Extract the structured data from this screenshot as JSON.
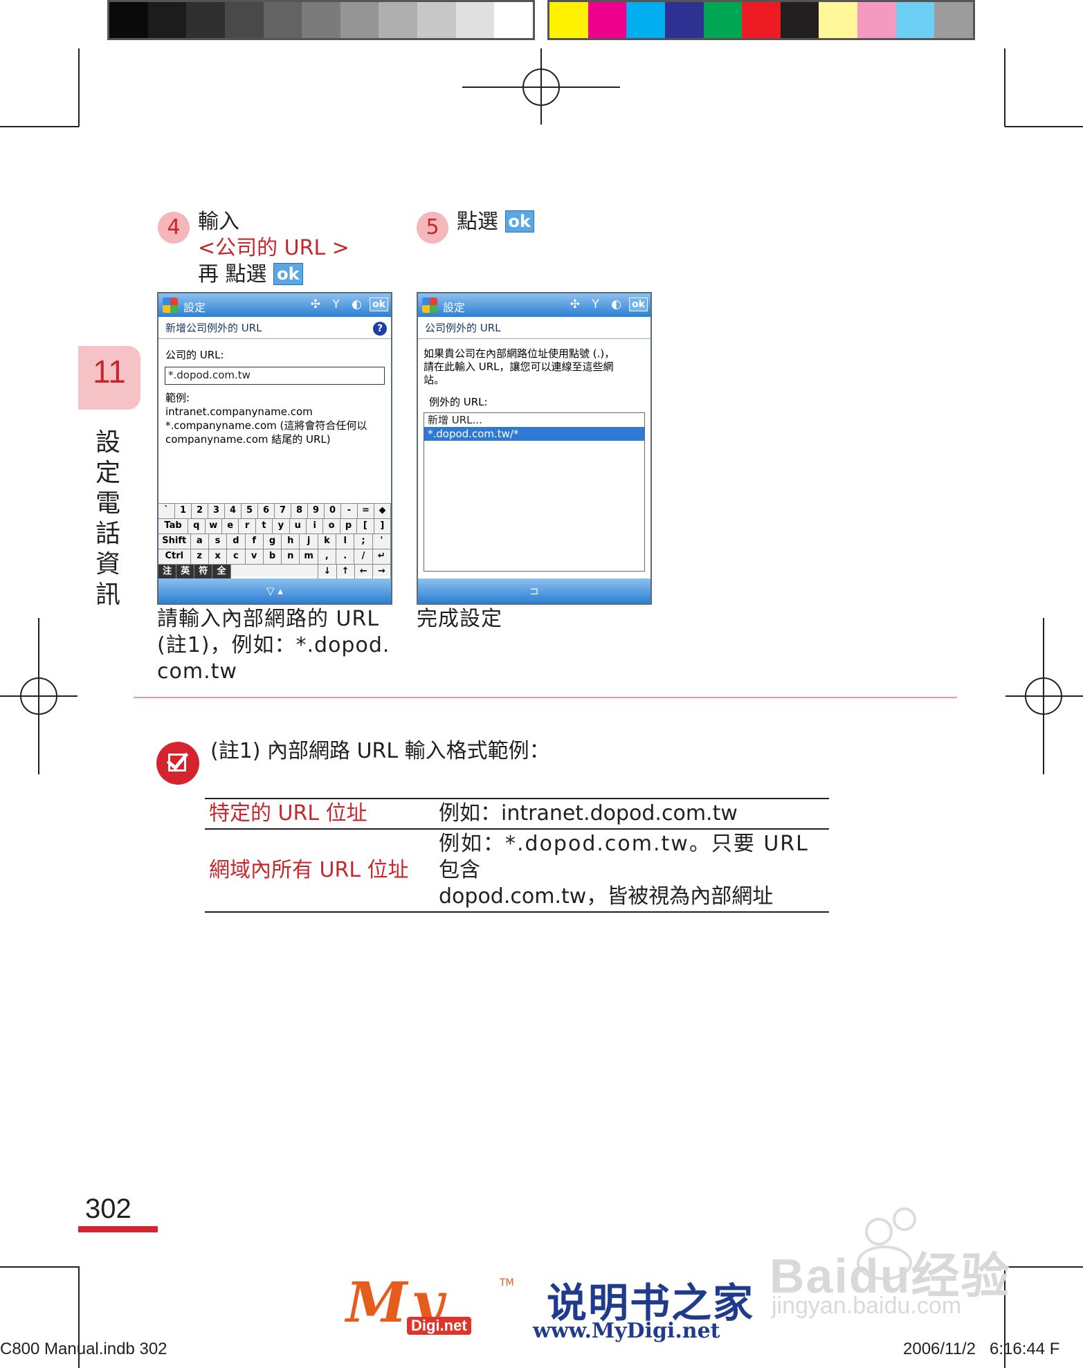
{
  "colors": {
    "gray_swatches": [
      "#0a0a0a",
      "#1c1c1c",
      "#303030",
      "#494949",
      "#636363",
      "#7b7b7b",
      "#959595",
      "#afafaf",
      "#c8c8c8",
      "#e0e0e0",
      "#ffffff"
    ],
    "color_swatches": [
      "#fff200",
      "#ec008c",
      "#00aeef",
      "#2e3192",
      "#00a651",
      "#ed1c24",
      "#231f20",
      "#fff799",
      "#f49ac1",
      "#6dcff6",
      "#9c9c9c"
    ],
    "accent": "#c7262d"
  },
  "chapter": {
    "number": "11",
    "title": "設定電話資訊"
  },
  "steps": [
    {
      "number": "4",
      "line1": "輸入",
      "line2": "<公司的 URL >",
      "line3": "再 點選",
      "ok": "ok"
    },
    {
      "number": "5",
      "line1": "點選",
      "ok": "ok"
    }
  ],
  "screen1": {
    "title": "設定",
    "ok": "ok",
    "subtitle": "新增公司例外的 URL",
    "field_label": "公司的 URL:",
    "field_value": "*.dopod.com.tw",
    "example_label": "範例:",
    "example1": "intranet.companyname.com",
    "example2": "*.companyname.com (這將會符合任何以",
    "example3": "companyname.com 結尾的 URL)",
    "kb_rows": [
      [
        "`",
        "1",
        "2",
        "3",
        "4",
        "5",
        "6",
        "7",
        "8",
        "9",
        "0",
        "-",
        "=",
        "◆"
      ],
      [
        "Tab",
        "q",
        "w",
        "e",
        "r",
        "t",
        "y",
        "u",
        "i",
        "o",
        "p",
        "[",
        "]"
      ],
      [
        "Shift",
        "a",
        "s",
        "d",
        "f",
        "g",
        "h",
        "j",
        "k",
        "l",
        ";",
        "'"
      ],
      [
        "Ctrl",
        "z",
        "x",
        "c",
        "v",
        "b",
        "n",
        "m",
        ",",
        ".",
        "/",
        "↵"
      ]
    ],
    "kb_last": [
      "注",
      "英",
      "符",
      "全",
      "",
      "↓",
      "↑",
      "←",
      "→"
    ]
  },
  "screen2": {
    "title": "設定",
    "ok": "ok",
    "subtitle": "公司例外的 URL",
    "desc1": "如果貴公司在內部網路位址使用點號 (.)，",
    "desc2": "請在此輸入 URL，讓您可以連線至這些網",
    "desc3": "站。",
    "list_label": "例外的 URL:",
    "list_items": [
      "新增 URL...",
      "*.dopod.com.tw/*"
    ]
  },
  "captions": {
    "c1_line1": "請輸入內部網路的 URL",
    "c1_line2": "(註1)，例如：*.dopod.",
    "c1_line3": "com.tw",
    "c2": "完成設定"
  },
  "note": {
    "text": "(註1) 內部網路 URL 輸入格式範例：",
    "rows": [
      {
        "key": "特定的 URL 位址",
        "value1": "例如：intranet.dopod.com.tw",
        "value2": "",
        "value3": ""
      },
      {
        "key": "網域內所有 URL 位址",
        "value1": "例如：*.dopod.com.tw。只要 URL",
        "value2": "包含",
        "value3": "dopod.com.tw，皆被視為內部網址"
      }
    ]
  },
  "page_number": "302",
  "slug": {
    "left": "C800 Manual.indb   302",
    "right": "2006/11/2   6:16:44 F"
  },
  "logos": {
    "my": "My",
    "tm": "TM",
    "digi": "Digi.net",
    "brand": "说明书之家",
    "url": "www.MyDigi.net",
    "baidu": "Baidu经验",
    "baidu_sub": "jingyan.baidu.com"
  }
}
